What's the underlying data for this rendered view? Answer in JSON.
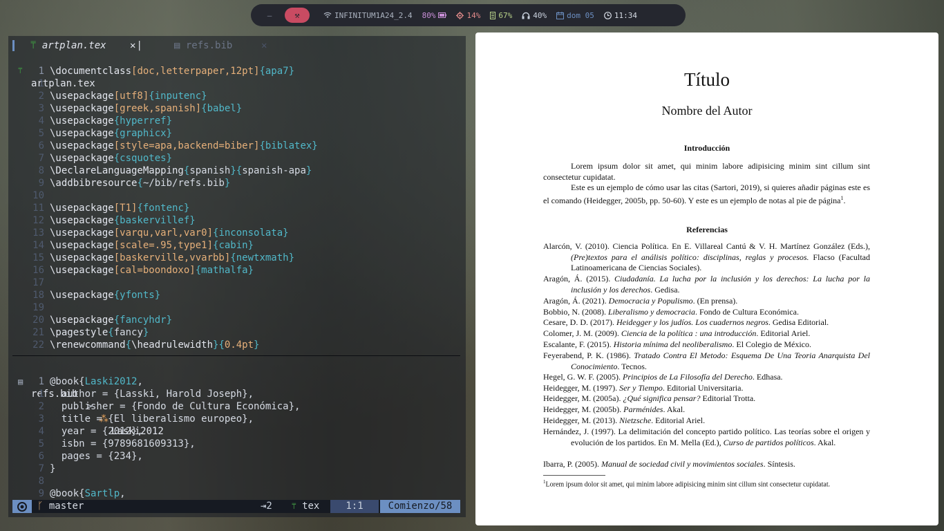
{
  "topbar": {
    "workspaces": [
      {
        "label": "—"
      },
      {
        "label": "⚒"
      }
    ],
    "wifi": "INFINITUM1A24_2.4",
    "battery": "80%",
    "cpu": "14%",
    "memory": "67%",
    "volume": "40%",
    "date": "dom 05",
    "time": "11:34"
  },
  "editor": {
    "tabs": [
      {
        "label": "artplan.tex",
        "close": "✕"
      },
      {
        "label": "refs.bib",
        "close": "✕"
      }
    ],
    "winbar1": "artplan.tex",
    "tex_lines": [
      {
        "n": "1",
        "parts": [
          [
            "k",
            "\\documentclass"
          ],
          [
            "o",
            "[doc,letterpaper,12pt]"
          ],
          [
            "c",
            "{apa7}"
          ]
        ]
      },
      {
        "n": "1",
        "parts": []
      },
      {
        "n": "2",
        "parts": [
          [
            "k",
            "\\usepackage"
          ],
          [
            "o",
            "[utf8]"
          ],
          [
            "c",
            "{inputenc}"
          ]
        ]
      },
      {
        "n": "3",
        "parts": [
          [
            "k",
            "\\usepackage"
          ],
          [
            "o",
            "[greek,spanish]"
          ],
          [
            "c",
            "{babel}"
          ]
        ]
      },
      {
        "n": "4",
        "parts": [
          [
            "k",
            "\\usepackage"
          ],
          [
            "c",
            "{hyperref}"
          ]
        ]
      },
      {
        "n": "5",
        "parts": [
          [
            "k",
            "\\usepackage"
          ],
          [
            "c",
            "{graphicx}"
          ]
        ]
      },
      {
        "n": "6",
        "parts": [
          [
            "k",
            "\\usepackage"
          ],
          [
            "o",
            "[style=apa,backend=biber]"
          ],
          [
            "c",
            "{biblatex}"
          ]
        ]
      },
      {
        "n": "7",
        "parts": [
          [
            "k",
            "\\usepackage"
          ],
          [
            "c",
            "{csquotes}"
          ]
        ]
      },
      {
        "n": "8",
        "parts": [
          [
            "k",
            "\\DeclareLanguageMapping"
          ],
          [
            "c",
            "{"
          ],
          [
            "w",
            "spanish"
          ],
          [
            "c",
            "}{"
          ],
          [
            "w",
            "spanish-apa"
          ],
          [
            "c",
            "}"
          ]
        ]
      },
      {
        "n": "9",
        "parts": [
          [
            "k",
            "\\addbibresource"
          ],
          [
            "c",
            "{"
          ],
          [
            "w",
            "~/bib/refs.bib"
          ],
          [
            "c",
            "}"
          ]
        ]
      },
      {
        "n": "10",
        "parts": []
      },
      {
        "n": "11",
        "parts": [
          [
            "k",
            "\\usepackage"
          ],
          [
            "o",
            "[T1]"
          ],
          [
            "c",
            "{fontenc}"
          ]
        ]
      },
      {
        "n": "12",
        "parts": [
          [
            "k",
            "\\usepackage"
          ],
          [
            "c",
            "{baskervillef}"
          ]
        ]
      },
      {
        "n": "13",
        "parts": [
          [
            "k",
            "\\usepackage"
          ],
          [
            "o",
            "[varqu,varl,var0]"
          ],
          [
            "c",
            "{inconsolata}"
          ]
        ]
      },
      {
        "n": "14",
        "parts": [
          [
            "k",
            "\\usepackage"
          ],
          [
            "o",
            "[scale=.95,type1]"
          ],
          [
            "c",
            "{cabin}"
          ]
        ]
      },
      {
        "n": "15",
        "parts": [
          [
            "k",
            "\\usepackage"
          ],
          [
            "o",
            "[baskerville,vvarbb]"
          ],
          [
            "c",
            "{newtxmath}"
          ]
        ]
      },
      {
        "n": "16",
        "parts": [
          [
            "k",
            "\\usepackage"
          ],
          [
            "o",
            "[cal=boondoxo]"
          ],
          [
            "c",
            "{mathalfa}"
          ]
        ]
      },
      {
        "n": "17",
        "parts": []
      },
      {
        "n": "18",
        "parts": [
          [
            "k",
            "\\usepackage"
          ],
          [
            "c",
            "{yfonts}"
          ]
        ]
      },
      {
        "n": "19",
        "parts": []
      },
      {
        "n": "20",
        "parts": [
          [
            "k",
            "\\usepackage"
          ],
          [
            "c",
            "{fancyhdr}"
          ]
        ]
      },
      {
        "n": "21",
        "parts": [
          [
            "k",
            "\\pagestyle"
          ],
          [
            "c",
            "{"
          ],
          [
            "w",
            "fancy"
          ],
          [
            "c",
            "}"
          ]
        ]
      },
      {
        "n": "22",
        "parts": [
          [
            "k",
            "\\renewcommand"
          ],
          [
            "c",
            "{"
          ],
          [
            "k",
            "\\headrulewidth"
          ],
          [
            "c",
            "}{"
          ],
          [
            "o",
            "0.4pt"
          ],
          [
            "c",
            "}"
          ]
        ]
      }
    ],
    "winbar2_file": "refs.bib",
    "winbar2_sep": ">",
    "winbar2_symbol": "Laski2012",
    "bib_lines": [
      {
        "n": "1",
        "parts": [
          [
            "w",
            "@book{"
          ],
          [
            "c",
            "Laski2012"
          ],
          [
            "w",
            ","
          ]
        ]
      },
      {
        "n": "1",
        "parts": [
          [
            "w",
            "  author = {Lasski, Harold Joseph},"
          ]
        ]
      },
      {
        "n": "2",
        "parts": [
          [
            "w",
            "  publisher = {Fondo de Cultura Económica},"
          ]
        ]
      },
      {
        "n": "3",
        "parts": [
          [
            "w",
            "  title = {El liberalismo europeo},"
          ]
        ]
      },
      {
        "n": "4",
        "parts": [
          [
            "w",
            "  year = {2012},"
          ]
        ]
      },
      {
        "n": "5",
        "parts": [
          [
            "w",
            "  isbn = {9789681609313},"
          ]
        ]
      },
      {
        "n": "6",
        "parts": [
          [
            "w",
            "  pages = {234},"
          ]
        ]
      },
      {
        "n": "7",
        "parts": [
          [
            "w",
            "}"
          ]
        ]
      },
      {
        "n": "8",
        "parts": []
      },
      {
        "n": "9",
        "parts": [
          [
            "w",
            "@book{"
          ],
          [
            "c",
            "Sartlp"
          ],
          [
            "w",
            ","
          ]
        ]
      }
    ],
    "status": {
      "branch": "master",
      "indent": "⇥2",
      "filetype": "tex",
      "position": "1:1",
      "progress": "Comienzo/58"
    }
  },
  "pdf": {
    "title": "Título",
    "author": "Nombre del Autor",
    "intro_heading": "Introducción",
    "para1": "Lorem ipsum dolor sit amet, qui minim labore adipisicing minim sint cillum sint consectetur cupidatat.",
    "para2": "Este es un ejemplo de cómo usar las citas (Sartori, 2019), si quieres añadir páginas este es el comando (Heidegger, 2005b, pp. 50-60). Y este es un ejemplo de notas al pie de página",
    "para2_sup": "1",
    "para2_end": ".",
    "refs_heading": "Referencias",
    "refs": [
      {
        "pre": "Alarcón, V. (2010). Ciencia Política. En E. Villareal Cantú & V. H. Martínez González (Eds.), ",
        "it": "(Pre)textos para el análisis político: disciplinas, reglas y procesos.",
        "post": " Flacso (Facultad Latinoamericana de Ciencias Sociales)."
      },
      {
        "pre": "Aragón, Á. (2015). ",
        "it": "Ciudadanía. La lucha por la inclusión y los derechos: La lucha por la inclusión y los derechos",
        "post": ". Gedisa."
      },
      {
        "pre": "Aragón, Á. (2021). ",
        "it": "Democracia y Populismo",
        "post": ". (En prensa)."
      },
      {
        "pre": "Bobbio, N. (2008). ",
        "it": "Liberalismo y democracia",
        "post": ". Fondo de Cultura Económica."
      },
      {
        "pre": "Cesare, D. D. (2017). ",
        "it": "Heidegger y los judíos. Los cuadernos negros",
        "post": ". Gedisa Editorial."
      },
      {
        "pre": "Colomer, J. M. (2009). ",
        "it": "Ciencia de la política : una introducción",
        "post": ". Editorial Ariel."
      },
      {
        "pre": "Escalante, F. (2015). ",
        "it": "Historia mínima del neoliberalismo",
        "post": ". El Colegio de México."
      },
      {
        "pre": "Feyerabend, P. K. (1986). ",
        "it": "Tratado Contra El Metodo: Esquema De Una Teoria Anarquista Del Conocimiento",
        "post": ". Tecnos."
      },
      {
        "pre": "Hegel, G. W. F. (2005). ",
        "it": "Principios de La Filosofía del Derecho",
        "post": ". Edhasa."
      },
      {
        "pre": "Heidegger, M. (1997). ",
        "it": "Ser y Tiempo",
        "post": ". Editorial Universitaria."
      },
      {
        "pre": "Heidegger, M. (2005a). ",
        "it": "¿Qué significa pensar?",
        "post": " Editorial Trotta."
      },
      {
        "pre": "Heidegger, M. (2005b). ",
        "it": "Parménides",
        "post": ". Akal."
      },
      {
        "pre": "Heidegger, M. (2013). ",
        "it": "Nietzsche",
        "post": ". Editorial Ariel."
      },
      {
        "pre": "Hernández, J. (1997). La delimitación del concepto partido político. Las teorías sobre el origen y evolución de los partidos. En M. Mella (Ed.), ",
        "it": "Curso de partidos políticos",
        "post": ". Akal."
      },
      {
        "pre": "Ibarra, P. (2005). ",
        "it": "Manual de sociedad civil y movimientos sociales",
        "post": ". Síntesis."
      }
    ],
    "footnote_num": "1",
    "footnote": "Lorem ipsum dolor sit amet, qui minim labore adipisicing minim sint cillum sint consectetur cupidatat."
  }
}
